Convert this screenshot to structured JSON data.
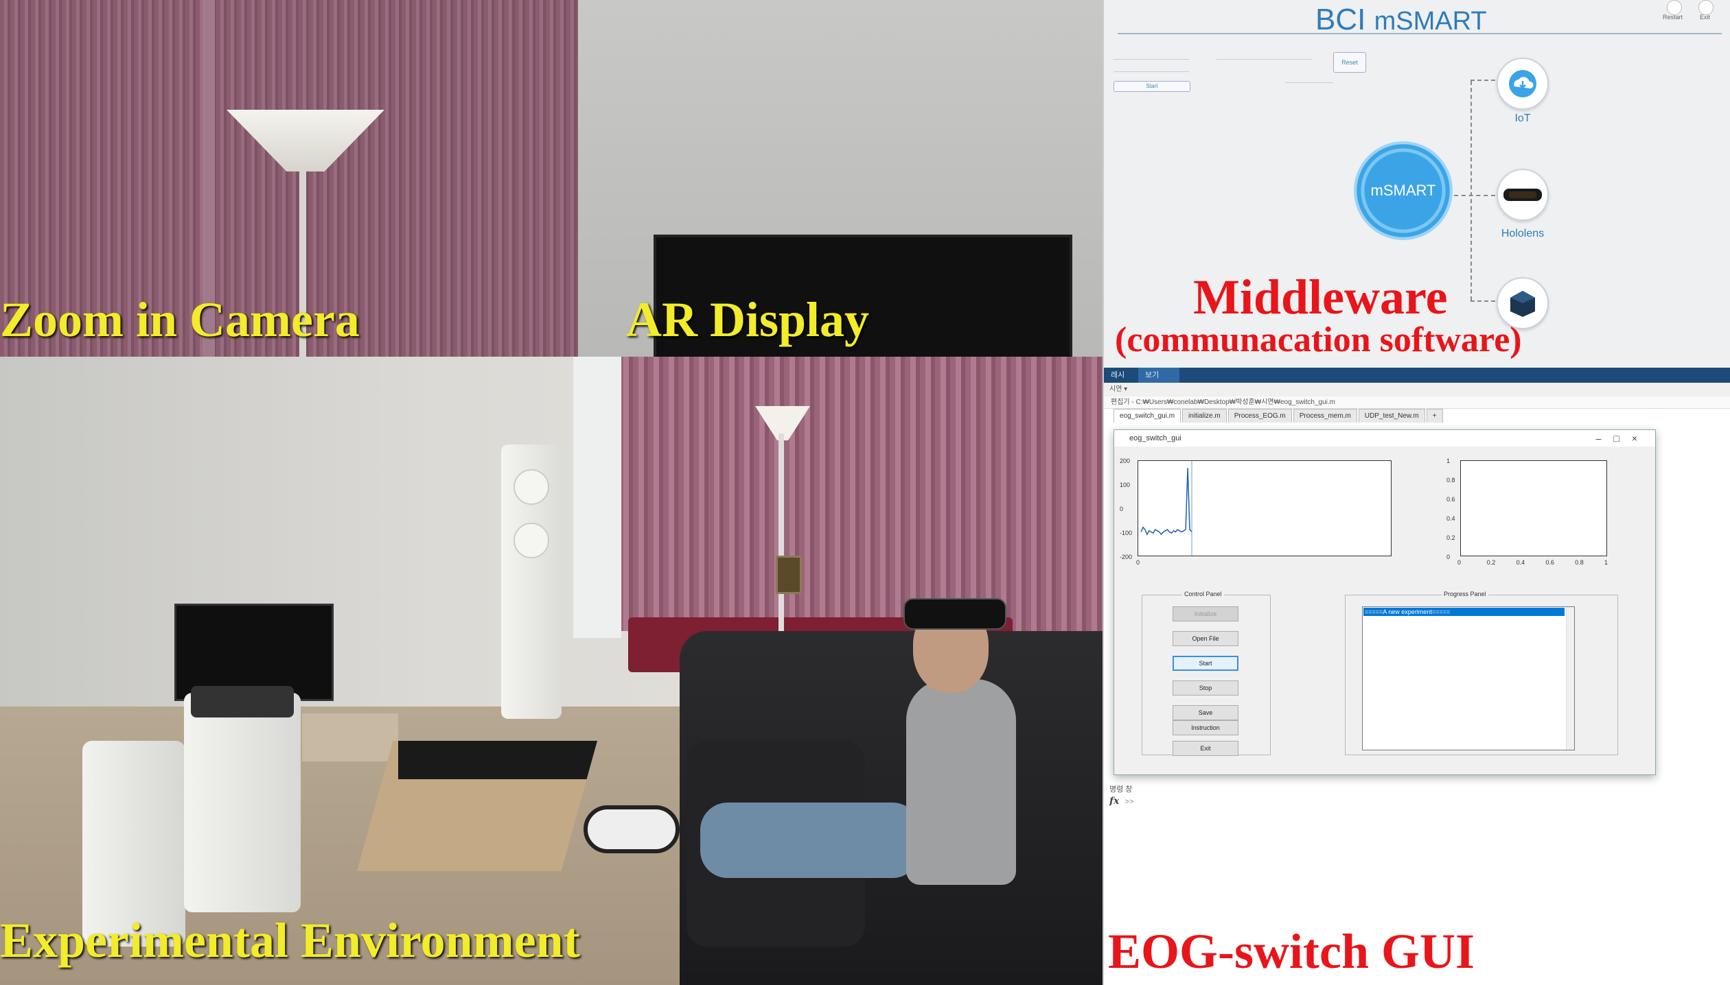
{
  "captions": {
    "zoom": "Zoom in Camera",
    "ar": "AR Display",
    "middleware_title": "Middleware",
    "middleware_sub": "(communacation software)",
    "environment": "Experimental Environment",
    "gui": "EOG-switch GUI"
  },
  "middleware": {
    "brand_bci": "BCI",
    "brand_msmart": "mSMART",
    "top_buttons": [
      "Restart",
      "Exit"
    ],
    "reset_label": "Reset",
    "start_label": "Start",
    "hub_label": "mSMART",
    "nodes": {
      "iot": "IoT",
      "hololens": "Hololens"
    }
  },
  "gui": {
    "tabs": [
      "레시",
      "보기"
    ],
    "section": "시연 ▾",
    "editor_path": "편집기 - C:₩Users₩conelab₩Desktop₩박성훈₩시연₩eog_switch_gui.m",
    "file_tabs": [
      "eog_switch_gui.m",
      "initialize.m",
      "Process_EOG.m",
      "Process_mem.m",
      "UDP_test_New.m",
      "+"
    ],
    "command_label": "명령 창",
    "command_prompt": "fx",
    "command_arrows": ">>",
    "figure": {
      "title": "eog_switch_gui",
      "left_plot": {
        "yticks": [
          "200",
          "100",
          "0",
          "-100",
          "-200"
        ],
        "xticks": [
          "0"
        ]
      },
      "right_plot": {
        "yticks": [
          "1",
          "0.8",
          "0.6",
          "0.4",
          "0.2",
          "0"
        ],
        "xticks": [
          "0",
          "0.2",
          "0.4",
          "0.6",
          "0.8",
          "1"
        ]
      },
      "control_panel": {
        "title": "Control Panel",
        "buttons": [
          "Initialize",
          "Open File",
          "Start",
          "Stop",
          "Save",
          "Instruction",
          "Exit"
        ]
      },
      "progress_panel": {
        "title": "Progress Panel",
        "selected_line": "=====A new experiment====="
      }
    }
  },
  "colors": {
    "caption_yellow": "#f2ec2a",
    "caption_red": "#e8151a",
    "brand_blue": "#2f7cb8",
    "matlab_bar": "#1c4b7a"
  },
  "chart_data": [
    {
      "type": "line",
      "xlabel": "",
      "ylabel": "",
      "ylim": [
        -200,
        200
      ],
      "series": [
        {
          "values": [
            -100,
            -80,
            -90,
            -110,
            -95,
            -100,
            -105,
            -90,
            -95,
            -100,
            -110,
            -100,
            -95,
            -90,
            -100,
            -105,
            -95,
            -100,
            -90,
            -95,
            -100,
            -95,
            -90,
            170,
            -90,
            -100
          ]
        }
      ]
    },
    {
      "type": "line",
      "xlabel": "",
      "ylabel": "",
      "xlim": [
        0,
        1
      ],
      "ylim": [
        0,
        1
      ],
      "series": []
    }
  ]
}
